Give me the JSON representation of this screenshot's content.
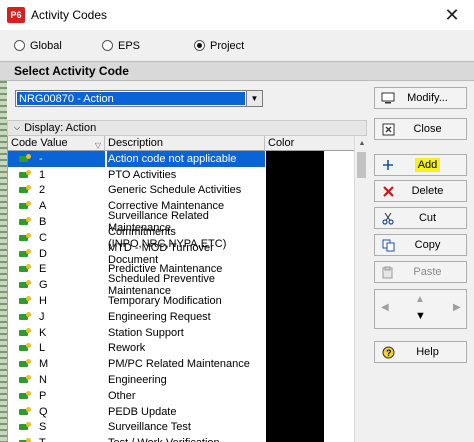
{
  "window": {
    "app_logo": "P6",
    "title": "Activity Codes",
    "close_glyph": "✕"
  },
  "scope": {
    "options": [
      {
        "label": "Global",
        "checked": false
      },
      {
        "label": "EPS",
        "checked": false
      },
      {
        "label": "Project",
        "checked": true
      }
    ]
  },
  "section": {
    "title": "Select Activity Code"
  },
  "code_select": {
    "value": "NRG00870 - Action",
    "arrow": "▼"
  },
  "buttons": {
    "modify": "Modify...",
    "close": "Close",
    "add": "Add",
    "delete": "Delete",
    "cut": "Cut",
    "copy": "Copy",
    "paste": "Paste",
    "help": "Help"
  },
  "display": {
    "chevron": "⌵",
    "label": "Display: Action"
  },
  "grid": {
    "columns": {
      "code": "Code Value",
      "description": "Description",
      "color": "Color"
    },
    "rows": [
      {
        "code": "-",
        "description": "Action code not applicable",
        "selected": true
      },
      {
        "code": "1",
        "description": "PTO Activities"
      },
      {
        "code": "2",
        "description": "Generic Schedule Activities"
      },
      {
        "code": "A",
        "description": "Corrective Maintenance"
      },
      {
        "code": "B",
        "description": "Surveillance Related Maintenance"
      },
      {
        "code": "C",
        "description": "Commitments (INPO,NRC,NYPA,ETC)"
      },
      {
        "code": "D",
        "description": "MTD - MOD Turnover Document"
      },
      {
        "code": "E",
        "description": "Predictive Maintenance"
      },
      {
        "code": "G",
        "description": "Scheduled Preventive Maintenance"
      },
      {
        "code": "H",
        "description": "Temporary Modification"
      },
      {
        "code": "J",
        "description": "Engineering Request"
      },
      {
        "code": "K",
        "description": "Station Support"
      },
      {
        "code": "L",
        "description": "Rework"
      },
      {
        "code": "M",
        "description": "PM/PC Related Maintenance"
      },
      {
        "code": "N",
        "description": "Engineering"
      },
      {
        "code": "P",
        "description": "Other"
      },
      {
        "code": "Q",
        "description": "PEDB Update"
      },
      {
        "code": "S",
        "description": "Surveillance Test"
      },
      {
        "code": "T",
        "description": "Test / Work Verification"
      }
    ]
  },
  "colors": {
    "selection": "#0a64d8",
    "add_highlight": "#f6f020"
  }
}
